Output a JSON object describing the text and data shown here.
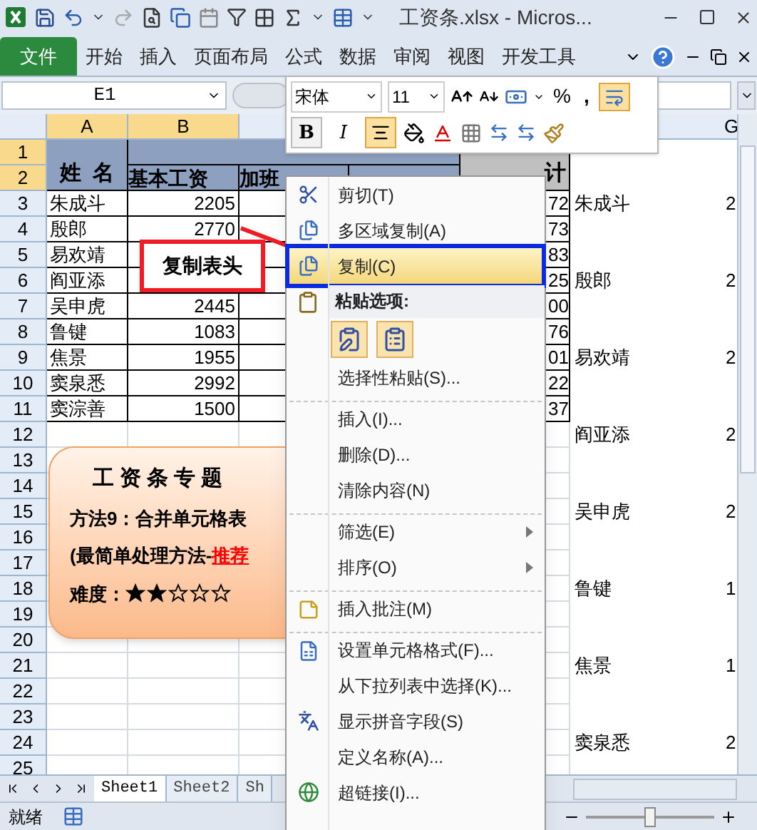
{
  "title_bar": {
    "title": "工资条.xlsx  -  Micros..."
  },
  "ribbon_tabs": [
    {
      "label": "文件",
      "kind": "file"
    },
    {
      "label": "开始",
      "kind": "tab"
    },
    {
      "label": "插入",
      "kind": "tab"
    },
    {
      "label": "页面布局",
      "kind": "tab"
    },
    {
      "label": "公式",
      "kind": "tab"
    },
    {
      "label": "数据",
      "kind": "tab"
    },
    {
      "label": "审阅",
      "kind": "tab"
    },
    {
      "label": "视图",
      "kind": "tab"
    },
    {
      "label": "开发工具",
      "kind": "tab"
    }
  ],
  "name_box": {
    "value": "E1"
  },
  "mini_toolbar": {
    "font": "宋体",
    "size": "11",
    "percent": "%",
    "comma": ",",
    "bold": "B",
    "italic": "I",
    "center_align_on": true,
    "wrap_text_on": true
  },
  "columns": [
    {
      "label": "A",
      "selected": true
    },
    {
      "label": "B",
      "selected": true
    },
    {
      "label": "G",
      "selected": false
    }
  ],
  "row_numbers": [
    {
      "label": "1",
      "selected": true
    },
    {
      "label": "2",
      "selected": true
    },
    {
      "label": "3",
      "selected": false
    },
    {
      "label": "4",
      "selected": false
    },
    {
      "label": "5",
      "selected": false
    },
    {
      "label": "6",
      "selected": false
    },
    {
      "label": "7",
      "selected": false
    },
    {
      "label": "8",
      "selected": false
    },
    {
      "label": "9",
      "selected": false
    },
    {
      "label": "10",
      "selected": false
    },
    {
      "label": "11",
      "selected": false
    },
    {
      "label": "12",
      "selected": false
    },
    {
      "label": "13",
      "selected": false
    },
    {
      "label": "14",
      "selected": false
    },
    {
      "label": "15",
      "selected": false
    },
    {
      "label": "16",
      "selected": false
    },
    {
      "label": "17",
      "selected": false
    },
    {
      "label": "18",
      "selected": false
    },
    {
      "label": "19",
      "selected": false
    },
    {
      "label": "20",
      "selected": false
    },
    {
      "label": "21",
      "selected": false
    },
    {
      "label": "22",
      "selected": false
    },
    {
      "label": "23",
      "selected": false
    },
    {
      "label": "24",
      "selected": false
    },
    {
      "label": "25",
      "selected": false
    }
  ],
  "header": {
    "name": "姓  名",
    "base": "基本工资",
    "overtime": "加班",
    "total": "计"
  },
  "employees": [
    {
      "name": "朱成斗",
      "base": "2205",
      "total": "72"
    },
    {
      "name": "殷郎",
      "base": "2770",
      "total": "73"
    },
    {
      "name": "易欢靖",
      "total": "83"
    },
    {
      "name": "阎亚添",
      "total": "25"
    },
    {
      "name": "吴申虎",
      "base": "2445",
      "total": "00"
    },
    {
      "name": "鲁键",
      "base": "1083",
      "total": "76"
    },
    {
      "name": "焦景",
      "base": "1955",
      "total": "01"
    },
    {
      "name": "窦泉悉",
      "base": "2992",
      "total": "22"
    },
    {
      "name": "窦淙善",
      "base": "1500",
      "total": "37"
    }
  ],
  "side_list": [
    {
      "name": "朱成斗",
      "value": "2"
    },
    {
      "name": "殷郎",
      "value": "2"
    },
    {
      "name": "易欢靖",
      "value": "2"
    },
    {
      "name": "阎亚添",
      "value": "2"
    },
    {
      "name": "吴申虎",
      "value": "2"
    },
    {
      "name": "鲁键",
      "value": "1"
    },
    {
      "name": "焦景",
      "value": "1"
    },
    {
      "name": "窦泉悉",
      "value": "2"
    }
  ],
  "callout": {
    "label": "复制表头"
  },
  "topic_card": {
    "title": "工资条专题",
    "method": "方法9：合并单元格表",
    "note_prefix": "(最简单处理方法-",
    "note_highlight": "推荐",
    "difficulty_label": "难度：",
    "stars": 2
  },
  "context_menu": [
    {
      "kind": "item",
      "label": "剪切(T)",
      "selected": false
    },
    {
      "kind": "item",
      "label": "多区域复制(A)",
      "selected": false
    },
    {
      "kind": "item",
      "label": "复制(C)",
      "selected": true
    },
    {
      "kind": "header",
      "label": "粘贴选项:"
    },
    {
      "kind": "paste_icons"
    },
    {
      "kind": "item",
      "label": "选择性粘贴(S)...",
      "selected": false
    },
    {
      "kind": "item",
      "label": "插入(I)...",
      "selected": false,
      "separator_before": true
    },
    {
      "kind": "item",
      "label": "删除(D)...",
      "selected": false
    },
    {
      "kind": "item",
      "label": "清除内容(N)",
      "selected": false
    },
    {
      "kind": "item",
      "label": "筛选(E)",
      "selected": false,
      "separator_before": true,
      "submenu": true
    },
    {
      "kind": "item",
      "label": "排序(O)",
      "selected": false,
      "submenu": true
    },
    {
      "kind": "item",
      "label": "插入批注(M)",
      "selected": false,
      "separator_before": true
    },
    {
      "kind": "item",
      "label": "设置单元格格式(F)...",
      "selected": false,
      "separator_before": true
    },
    {
      "kind": "item",
      "label": "从下拉列表中选择(K)...",
      "selected": false
    },
    {
      "kind": "item",
      "label": "显示拼音字段(S)",
      "selected": false
    },
    {
      "kind": "item",
      "label": "定义名称(A)...",
      "selected": false
    },
    {
      "kind": "item",
      "label": "超链接(I)...",
      "selected": false
    }
  ],
  "sheet_tabs": [
    {
      "label": "Sheet1",
      "selected": true
    },
    {
      "label": "Sheet2",
      "selected": false
    },
    {
      "label": "Sh",
      "selected": false
    }
  ],
  "status_bar": {
    "text": "就绪",
    "zoom": {
      "level": 0.5
    }
  }
}
